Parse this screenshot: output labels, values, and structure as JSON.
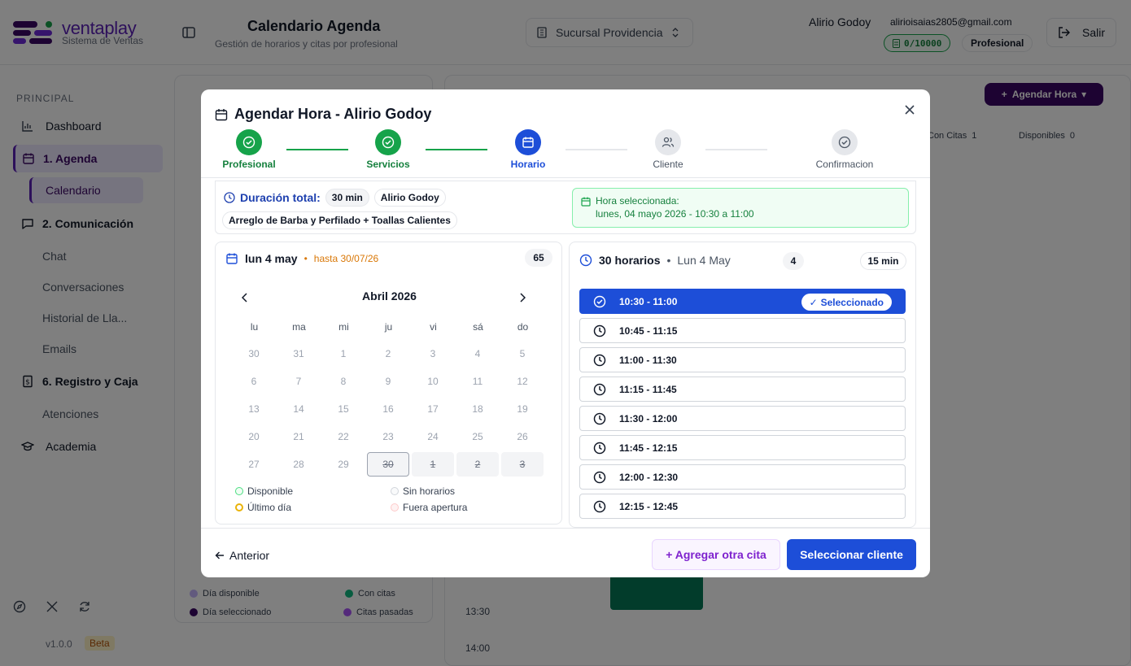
{
  "app": {
    "brand_name": "ventaplay",
    "brand_sub": "Sistema de Ventas",
    "page_title": "Calendario Agenda",
    "page_subtitle": "Gestión de horarios y citas por profesional",
    "branch": "Sucursal Providencia",
    "user_name": "Alirio Godoy",
    "user_email": "alirioisaias2805@gmail.com",
    "credits": "0/10000",
    "role": "Profesional",
    "logout": "Salir",
    "colors": {
      "brand": "#5b21b6",
      "primary": "#1d4ed8",
      "success": "#16a34a"
    }
  },
  "sidebar": {
    "section": "PRINCIPAL",
    "items": [
      {
        "label": "Dashboard",
        "icon": "chart-icon"
      },
      {
        "label": "1. Agenda",
        "icon": "calendar-icon"
      },
      {
        "label": "Calendario"
      },
      {
        "label": "2. Comunicación",
        "icon": "message-icon"
      },
      {
        "label": "Chat"
      },
      {
        "label": "Conversaciones"
      },
      {
        "label": "Historial de Lla..."
      },
      {
        "label": "Emails"
      },
      {
        "label": "6. Registro y Caja",
        "icon": "cash-icon"
      },
      {
        "label": "Atenciones"
      },
      {
        "label": "Academia",
        "icon": "graduation-icon"
      }
    ],
    "version": "v1.0.0",
    "beta": "Beta"
  },
  "background": {
    "agendar_button": "Agendar Hora",
    "chip_con_citas": "Con Citas",
    "chip_con_citas_count": "1",
    "chip_disponibles": "Disponibles",
    "chip_disponibles_count": "0",
    "times": [
      "13:30",
      "14:00"
    ],
    "legend": [
      "Día disponible",
      "Con citas",
      "Día seleccionado",
      "Citas pasadas"
    ]
  },
  "modal": {
    "title": "Agendar Hora - Alirio Godoy",
    "steps": [
      {
        "label": "Profesional",
        "state": "done"
      },
      {
        "label": "Servicios",
        "state": "done"
      },
      {
        "label": "Horario",
        "state": "current"
      },
      {
        "label": "Cliente",
        "state": "todo"
      },
      {
        "label": "Confirmacion",
        "state": "todo"
      }
    ],
    "summary": {
      "duration_label": "Duración total:",
      "duration_value": "30 min",
      "professional": "Alirio Godoy",
      "service": "Arreglo de Barba y Perfilado + Toallas Calientes",
      "selected_title": "Hora seleccionada:",
      "selected_value": "lunes, 04 mayo 2026 - 10:30 a 11:00"
    },
    "calendar": {
      "date": "lun 4 may",
      "separator": "•",
      "until": "hasta 30/07/26",
      "count": "65",
      "month": "Abril 2026",
      "weekdays": [
        "lu",
        "ma",
        "mi",
        "ju",
        "vi",
        "sá",
        "do"
      ],
      "weeks": [
        [
          "30",
          "31",
          "1",
          "2",
          "3",
          "4",
          "5"
        ],
        [
          "6",
          "7",
          "8",
          "9",
          "10",
          "11",
          "12"
        ],
        [
          "13",
          "14",
          "15",
          "16",
          "17",
          "18",
          "19"
        ],
        [
          "20",
          "21",
          "22",
          "23",
          "24",
          "25",
          "26"
        ],
        [
          "27",
          "28",
          "29",
          "30",
          "1",
          "2",
          "3"
        ]
      ],
      "legend": {
        "available": "Disponible",
        "no_slots": "Sin horarios",
        "last_day": "Último día",
        "out_of_hours": "Fuera apertura"
      }
    },
    "slots": {
      "count_label": "30 horarios",
      "separator": "•",
      "day_label": "Lun 4 May",
      "badge_count": "4",
      "interval": "15 min",
      "selected_pill": "Seleccionado",
      "items": [
        "10:30 - 11:00",
        "10:45 - 11:15",
        "11:00 - 11:30",
        "11:15 - 11:45",
        "11:30 - 12:00",
        "11:45 - 12:15",
        "12:00 - 12:30",
        "12:15 - 12:45"
      ]
    },
    "footer": {
      "previous": "Anterior",
      "add_another": "+ Agregar otra cita",
      "next": "Seleccionar cliente"
    }
  }
}
